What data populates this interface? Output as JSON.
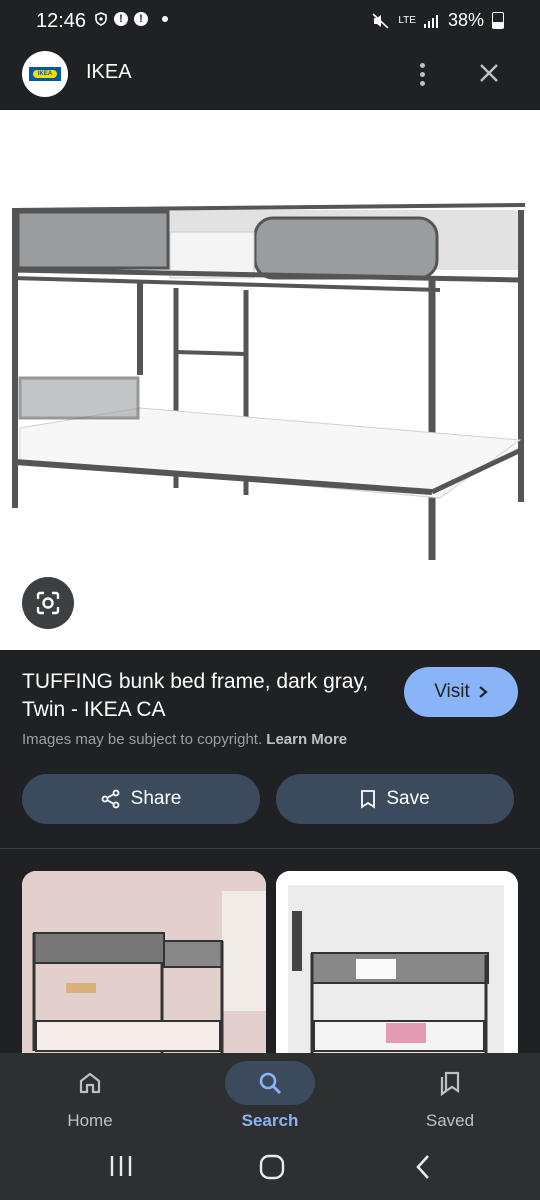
{
  "status_bar": {
    "time": "12:46",
    "network": "LTE",
    "battery": "38%"
  },
  "header": {
    "site_name": "IKEA",
    "logo_text": "IKEA"
  },
  "result": {
    "title": "TUFFING bunk bed frame, dark gray, Twin - IKEA CA",
    "visit_label": "Visit",
    "copyright_text": "Images may be subject to copyright.",
    "learn_more": "Learn More"
  },
  "actions": {
    "share_label": "Share",
    "save_label": "Save"
  },
  "bottom_nav": {
    "items": [
      {
        "label": "Home"
      },
      {
        "label": "Search"
      },
      {
        "label": "Saved"
      }
    ]
  },
  "colors": {
    "background": "#202124",
    "accent": "#8ab4f8",
    "button_bg": "#3c4a5e"
  }
}
